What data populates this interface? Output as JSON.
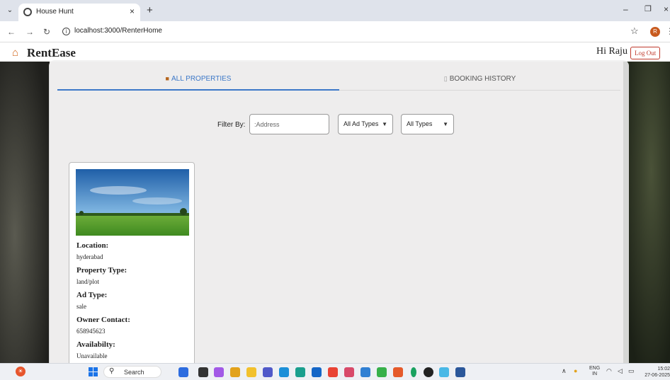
{
  "browser": {
    "tab_title": "House Hunt",
    "url": "localhost:3000/RenterHome",
    "profile_initial": "R"
  },
  "header": {
    "brand": "RentEase",
    "greeting": "Hi Raju",
    "logout_label": "Log Out"
  },
  "tabs": [
    {
      "label": "ALL PROPERTIES",
      "active": true
    },
    {
      "label": "BOOKING HISTORY",
      "active": false
    }
  ],
  "filters": {
    "label": "Filter By:",
    "address_placeholder": ":Address",
    "ad_type_selected": "All Ad Types",
    "type_selected": "All Types"
  },
  "property": {
    "location_label": "Location:",
    "location": "hyderabad",
    "property_type_label": "Property Type:",
    "property_type": "land/plot",
    "ad_type_label": "Ad Type:",
    "ad_type": "sale",
    "owner_contact_label": "Owner Contact:",
    "owner_contact": "658945623",
    "availability_label": "Availabilty:",
    "availability": "Unavailable"
  },
  "taskbar": {
    "search_label": "Search",
    "lang_top": "ENG",
    "lang_bottom": "IN",
    "time": "15:02",
    "date": "27-06-2025"
  },
  "colors": {
    "accent": "#3c78c8",
    "logout": "#c0392b"
  }
}
